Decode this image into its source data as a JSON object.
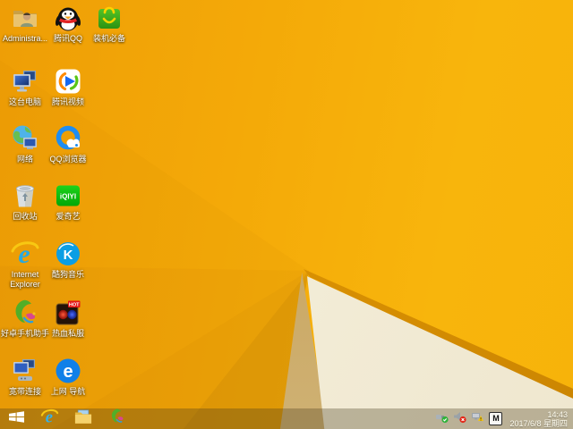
{
  "desktop": {
    "wallpaper": {
      "style": "windows-8.1-amber-polygonal",
      "colors": {
        "amber_main": "#f5ab08",
        "amber_bright": "#f8b50c",
        "facet_dark_orange": "#d98c06",
        "fold_strip": "#db8f04",
        "tan_wedge": "#c79f55",
        "cream_triangle": "#f6f0dc"
      }
    },
    "icons": [
      {
        "name": "administrator-folder",
        "label": "Administra..."
      },
      {
        "name": "tencent-qq",
        "label": "腾讯QQ"
      },
      {
        "name": "zhuangji-bibei",
        "label": "装机必备"
      },
      {
        "name": "this-pc",
        "label": "这台电脑"
      },
      {
        "name": "tencent-video",
        "label": "腾讯视频"
      },
      {
        "name": "network",
        "label": "网络"
      },
      {
        "name": "qq-browser",
        "label": "QQ浏览器"
      },
      {
        "name": "recycle-bin",
        "label": "回收站"
      },
      {
        "name": "iqiyi",
        "label": "爱奇艺",
        "icon_text": "iQIYI"
      },
      {
        "name": "internet-explorer",
        "label": "Internet Explorer"
      },
      {
        "name": "kugou-music",
        "label": "酷狗音乐",
        "icon_text": "K"
      },
      {
        "name": "haozhuo-assistant",
        "label": "好卓手机助手"
      },
      {
        "name": "rexue-sifu-game",
        "label": "热血私服",
        "badge": "HOT"
      },
      {
        "name": "broadband-connection",
        "label": "宽带连接"
      },
      {
        "name": "web-navigation",
        "label": "上网 导航",
        "icon_text": "e"
      }
    ]
  },
  "taskbar": {
    "buttons": [
      "start",
      "internet-explorer",
      "file-explorer",
      "haozhuo-assistant"
    ],
    "tray_icons": [
      "safely-remove-hardware",
      "volume-muted",
      "network-warning"
    ],
    "ime_label": "M",
    "clock": {
      "time": "14:43",
      "date": "2017/6/8 星期四"
    }
  }
}
